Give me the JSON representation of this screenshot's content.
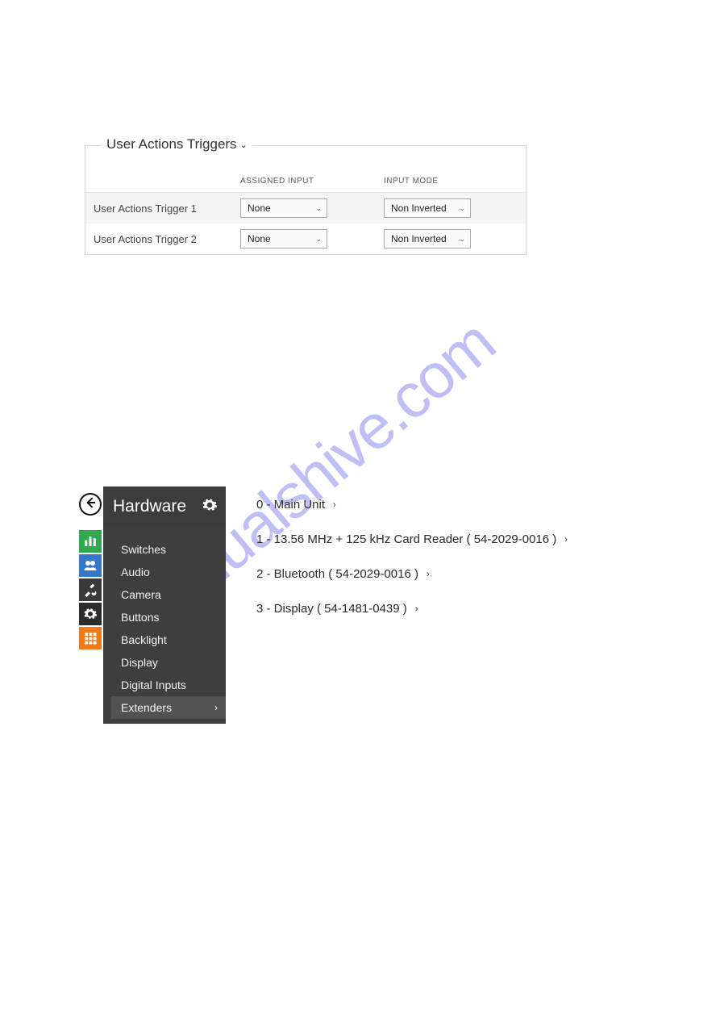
{
  "panel": {
    "title": "User Actions Triggers",
    "col_assigned": "ASSIGNED INPUT",
    "col_mode": "INPUT MODE",
    "rows": [
      {
        "label": "User Actions Trigger 1",
        "input": "None",
        "mode": "Non Inverted"
      },
      {
        "label": "User Actions Trigger 2",
        "input": "None",
        "mode": "Non Inverted"
      }
    ]
  },
  "sidebar": {
    "title": "Hardware",
    "items": [
      {
        "label": "Switches"
      },
      {
        "label": "Audio"
      },
      {
        "label": "Camera"
      },
      {
        "label": "Buttons"
      },
      {
        "label": "Backlight"
      },
      {
        "label": "Display"
      },
      {
        "label": "Digital Inputs"
      },
      {
        "label": "Extenders"
      }
    ]
  },
  "extenders": [
    {
      "label": "0 - Main Unit"
    },
    {
      "label": "1 - 13.56 MHz + 125 kHz Card Reader ( 54-2029-0016 )"
    },
    {
      "label": "2 - Bluetooth ( 54-2029-0016 )"
    },
    {
      "label": "3 - Display ( 54-1481-0439 )"
    }
  ],
  "watermark": "manualshive.com"
}
